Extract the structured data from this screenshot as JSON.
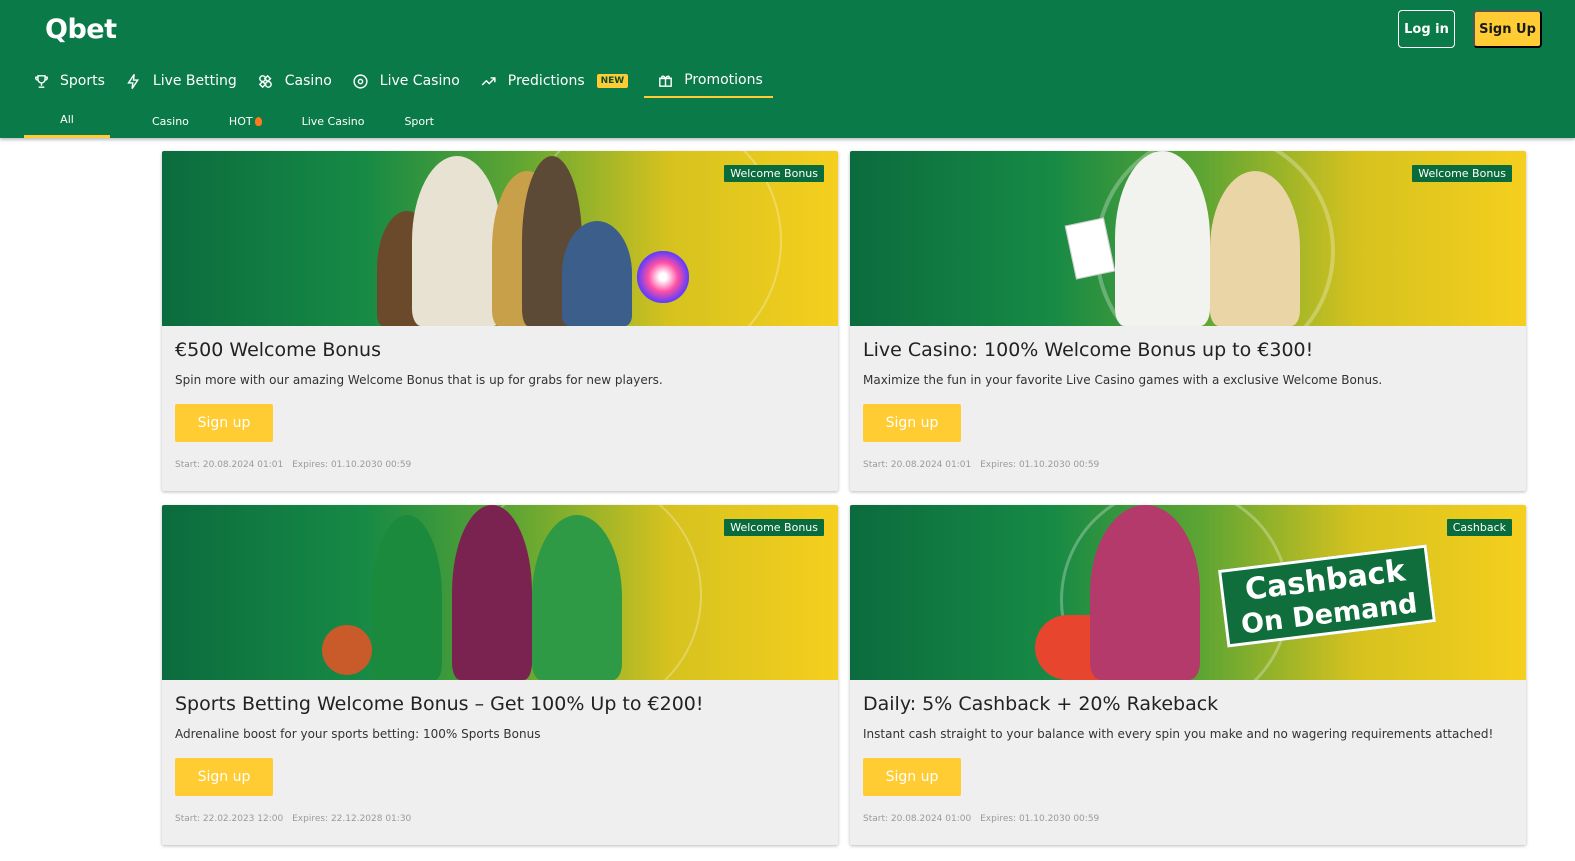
{
  "brand": {
    "logo": "Qbet"
  },
  "header": {
    "login_label": "Log in",
    "signup_label": "Sign Up"
  },
  "nav": {
    "items": [
      {
        "label": "Sports",
        "icon": "trophy-icon"
      },
      {
        "label": "Live Betting",
        "icon": "lightning-icon"
      },
      {
        "label": "Casino",
        "icon": "casino-chips-icon"
      },
      {
        "label": "Live Casino",
        "icon": "roulette-icon"
      },
      {
        "label": "Predictions",
        "icon": "trend-up-icon",
        "badge": "NEW"
      },
      {
        "label": "Promotions",
        "icon": "gift-icon",
        "active": true
      }
    ]
  },
  "subnav": {
    "items": [
      {
        "label": "All",
        "active": true
      },
      {
        "label": "Casino"
      },
      {
        "label": "HOT",
        "icon": "fire-icon"
      },
      {
        "label": "Live Casino"
      },
      {
        "label": "Sport"
      }
    ]
  },
  "colors": {
    "brand_green": "#0a7a48",
    "accent_yellow": "#ffcc33",
    "card_bg": "#efefef"
  },
  "promotions": [
    {
      "tag": "Welcome Bonus",
      "title": "€500 Welcome Bonus",
      "description": "Spin more with our amazing Welcome Bonus that is up for grabs for new players.",
      "button": "Sign up",
      "start": "Start: 20.08.2024 01:01",
      "expires": "Expires: 01.10.2030 00:59"
    },
    {
      "tag": "Welcome Bonus",
      "title": "Live Casino: 100% Welcome Bonus up to €300!",
      "description": "Maximize the fun in your favorite Live Casino games with a exclusive Welcome Bonus.",
      "button": "Sign up",
      "start": "Start: 20.08.2024 01:01",
      "expires": "Expires: 01.10.2030 00:59"
    },
    {
      "tag": "Welcome Bonus",
      "title": "Sports Betting Welcome Bonus – Get 100% Up to €200!",
      "description": "Adrenaline boost for your sports betting: 100% Sports Bonus",
      "button": "Sign up",
      "start": "Start: 22.02.2023 12:00",
      "expires": "Expires: 22.12.2028 01:30"
    },
    {
      "tag": "Cashback",
      "title": "Daily: 5% Cashback + 20% Rakeback",
      "description": "Instant cash straight to your balance with every spin you make and no wagering requirements attached!",
      "button": "Sign up",
      "start": "Start: 20.08.2024 01:00",
      "expires": "Expires: 01.10.2030 00:59",
      "banner_text_1": "Cashback",
      "banner_text_2": "On Demand"
    }
  ]
}
